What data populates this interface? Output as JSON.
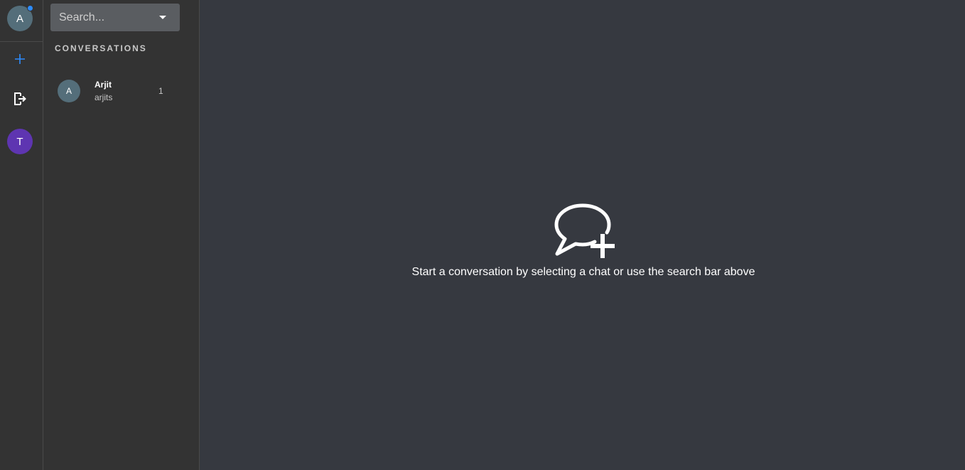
{
  "rail": {
    "self_avatar_initial": "A",
    "space_avatar_initial": "T",
    "icons": [
      "add-icon",
      "logout-icon"
    ]
  },
  "panel": {
    "search_placeholder": "Search...",
    "section_title": "CONVERSATIONS",
    "conversations": [
      {
        "initial": "A",
        "name": "Arjit",
        "subtitle": "arjits",
        "count": "1"
      }
    ]
  },
  "main": {
    "empty_icon": "chat-add-icon",
    "empty_text": "Start a conversation by selecting a chat or use the search bar above"
  },
  "colors": {
    "background": "#363940",
    "sidebar": "#333333",
    "accent": "#2d8cff",
    "avatar_gray": "#546e7a",
    "avatar_purple": "#5e35b1"
  }
}
